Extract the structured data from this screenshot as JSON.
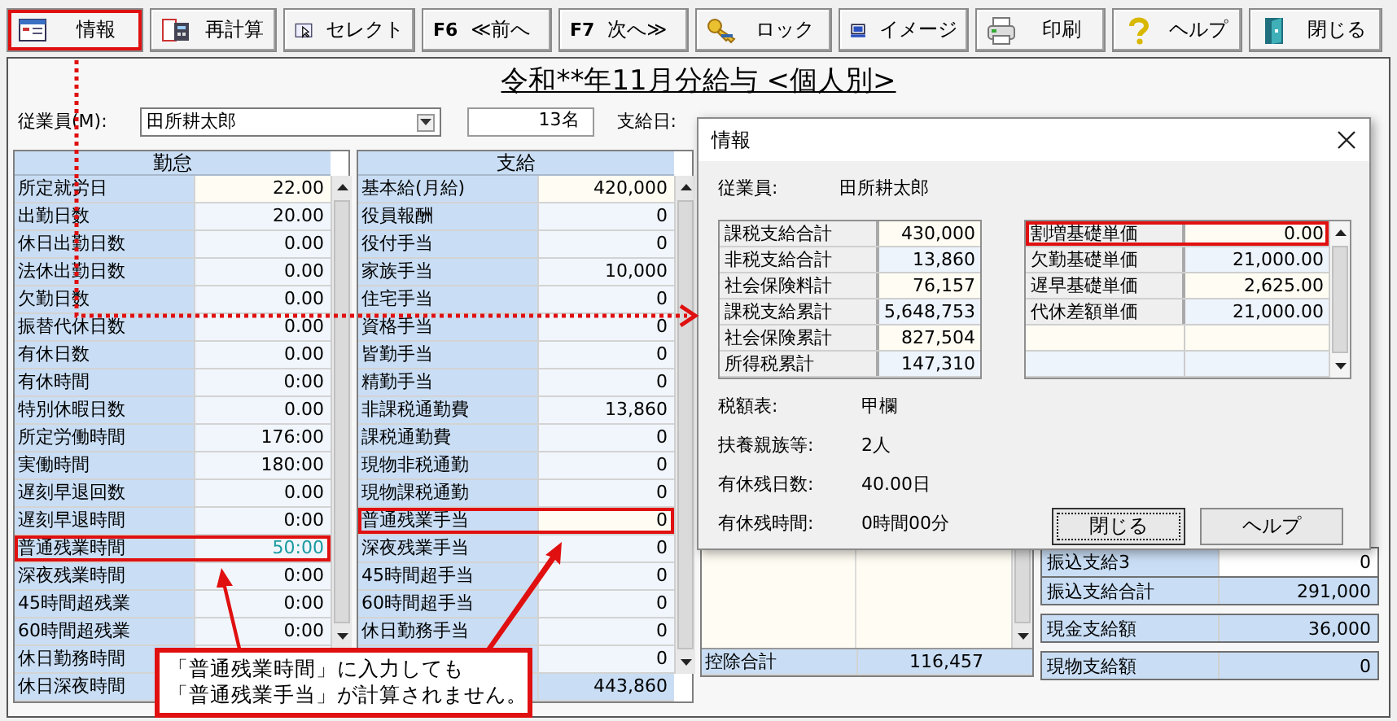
{
  "toolbar": [
    {
      "kind": "icon",
      "label": "情報",
      "highlighted": true
    },
    {
      "kind": "icon",
      "label": "再計算",
      "highlighted": false
    },
    {
      "kind": "icon",
      "label": "セレクト",
      "highlighted": false
    },
    {
      "kind": "fkey",
      "key": "F6",
      "label": "≪前へ",
      "highlighted": false
    },
    {
      "kind": "fkey",
      "key": "F7",
      "label": "次へ≫",
      "highlighted": false
    },
    {
      "kind": "icon",
      "label": "ロック",
      "highlighted": false
    },
    {
      "kind": "icon",
      "label": "イメージ",
      "highlighted": false
    },
    {
      "kind": "icon",
      "label": "印刷",
      "highlighted": false
    },
    {
      "kind": "icon",
      "label": "ヘルプ",
      "highlighted": false
    },
    {
      "kind": "icon",
      "label": "閉じる",
      "highlighted": false
    }
  ],
  "title": "令和**年11月分給与 <個人別>",
  "employee": {
    "label": "従業員(M):",
    "value": "田所耕太郎",
    "count": "13名",
    "pay_date_label": "支給日:"
  },
  "attendance": {
    "header": "勤怠",
    "rows": [
      {
        "label": "所定就労日",
        "value": "22.00",
        "entered": false,
        "highlighted": false
      },
      {
        "label": "出勤日数",
        "value": "20.00",
        "entered": false,
        "highlighted": false
      },
      {
        "label": "休日出勤日数",
        "value": "0.00",
        "entered": false,
        "highlighted": false
      },
      {
        "label": "法休出勤日数",
        "value": "0.00",
        "entered": false,
        "highlighted": false
      },
      {
        "label": "欠勤日数",
        "value": "0.00",
        "entered": false,
        "highlighted": false
      },
      {
        "label": "振替代休日数",
        "value": "0.00",
        "entered": false,
        "highlighted": false
      },
      {
        "label": "有休日数",
        "value": "0.00",
        "entered": false,
        "highlighted": false
      },
      {
        "label": "有休時間",
        "value": "0:00",
        "entered": false,
        "highlighted": false
      },
      {
        "label": "特別休暇日数",
        "value": "0.00",
        "entered": false,
        "highlighted": false
      },
      {
        "label": "所定労働時間",
        "value": "176:00",
        "entered": false,
        "highlighted": false
      },
      {
        "label": "実働時間",
        "value": "180:00",
        "entered": false,
        "highlighted": false
      },
      {
        "label": "遅刻早退回数",
        "value": "0.00",
        "entered": false,
        "highlighted": false
      },
      {
        "label": "遅刻早退時間",
        "value": "0:00",
        "entered": false,
        "highlighted": false
      },
      {
        "label": "普通残業時間",
        "value": "50:00",
        "entered": true,
        "highlighted": true
      },
      {
        "label": "深夜残業時間",
        "value": "0:00",
        "entered": false,
        "highlighted": false
      },
      {
        "label": "45時間超残業",
        "value": "0:00",
        "entered": false,
        "highlighted": false
      },
      {
        "label": "60時間超残業",
        "value": "0:00",
        "entered": false,
        "highlighted": false
      },
      {
        "label": "休日勤務時間",
        "highlighted": false
      },
      {
        "label": "休日深夜時間",
        "highlighted": false
      }
    ]
  },
  "payments": {
    "header": "支給",
    "rows": [
      {
        "label": "基本給(月給)",
        "value": "420,000",
        "highlighted": false
      },
      {
        "label": "役員報酬",
        "value": "0",
        "highlighted": false
      },
      {
        "label": "役付手当",
        "value": "0",
        "highlighted": false
      },
      {
        "label": "家族手当",
        "value": "10,000",
        "highlighted": false
      },
      {
        "label": "住宅手当",
        "value": "0",
        "highlighted": false
      },
      {
        "label": "資格手当",
        "value": "0",
        "highlighted": false
      },
      {
        "label": "皆勤手当",
        "value": "0",
        "highlighted": false
      },
      {
        "label": "精勤手当",
        "value": "0",
        "highlighted": false
      },
      {
        "label": "非課税通勤費",
        "value": "13,860",
        "highlighted": false
      },
      {
        "label": "課税通勤費",
        "value": "0",
        "highlighted": false
      },
      {
        "label": "現物非税通勤",
        "value": "0",
        "highlighted": false
      },
      {
        "label": "現物課税通勤",
        "value": "0",
        "highlighted": false
      },
      {
        "label": "普通残業手当",
        "value": "0",
        "highlighted": true
      },
      {
        "label": "深夜残業手当",
        "value": "0",
        "highlighted": false
      },
      {
        "label": "45時間超手当",
        "value": "0",
        "highlighted": false
      },
      {
        "label": "60時間超手当",
        "value": "0",
        "highlighted": false
      },
      {
        "label": "休日勤務手当",
        "value": "0",
        "highlighted": false
      },
      {
        "value": "0",
        "highlighted": false
      }
    ],
    "total": "443,860"
  },
  "deductions": {
    "total_label": "控除合計",
    "total": "116,457"
  },
  "summary": [
    {
      "kind": "item",
      "label": "振込支給3",
      "value": "0"
    },
    {
      "kind": "subtotal",
      "label": "振込支給合計",
      "value": "291,000"
    },
    {
      "kind": "amount",
      "label": "現金支給額",
      "value": "36,000"
    },
    {
      "kind": "amount",
      "label": "現物支給額",
      "value": "0"
    }
  ],
  "dialog": {
    "title": "情報",
    "employee_label": "従業員:",
    "employee": "田所耕太郎",
    "totals": [
      {
        "label": "課税支給合計",
        "value": "430,000"
      },
      {
        "label": "非税支給合計",
        "value": "13,860"
      },
      {
        "label": "社会保険料計",
        "value": "76,157"
      },
      {
        "label": "課税支給累計",
        "value": "5,648,753"
      },
      {
        "label": "社会保険累計",
        "value": "827,504"
      },
      {
        "label": "所得税累計",
        "value": "147,310"
      }
    ],
    "unit_prices": [
      {
        "label": "割増基礎単価",
        "value": "0.00",
        "highlighted": true
      },
      {
        "label": "欠勤基礎単価",
        "value": "21,000.00",
        "highlighted": false
      },
      {
        "label": "遅早基礎単価",
        "value": "2,625.00",
        "highlighted": false
      },
      {
        "label": "代休差額単価",
        "value": "21,000.00",
        "highlighted": false
      }
    ],
    "info": [
      {
        "label": "税額表:",
        "value": "甲欄"
      },
      {
        "label": "扶養親族等:",
        "value": "2人"
      },
      {
        "label": "有休残日数:",
        "value": "40.00日"
      },
      {
        "label": "有休残時間:",
        "value": "0時間00分"
      }
    ],
    "buttons": [
      "閉じる",
      "ヘルプ"
    ]
  },
  "callout": {
    "lines": [
      "「普通残業時間」に入力しても",
      "「普通残業手当」が計算されません。"
    ]
  }
}
